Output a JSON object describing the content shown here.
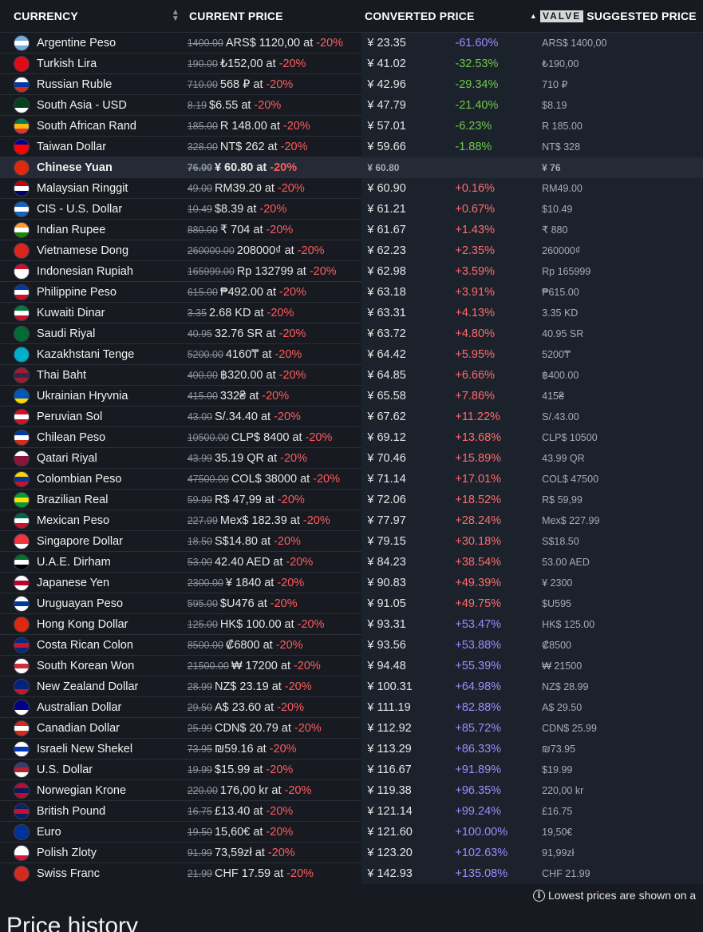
{
  "header": {
    "currency": "CURRENCY",
    "current_price": "CURRENT PRICE",
    "converted_price": "CONVERTED PRICE",
    "valve_logo": "VALVE",
    "suggested_price": "SUGGESTED PRICE"
  },
  "at_word": "at",
  "rows": [
    {
      "name": "Argentine Peso",
      "flag": [
        "#74acdf",
        "#ffffff",
        "#74acdf"
      ],
      "old": "1400.00",
      "now": "ARS$ 1120,00",
      "disc": "-20%",
      "conv": "¥ 23.35",
      "pct": "-61.60%",
      "cls": "pos-big",
      "sugg": "ARS$ 1400,00"
    },
    {
      "name": "Turkish Lira",
      "flag": [
        "#e30a17",
        "#e30a17",
        "#e30a17"
      ],
      "old": "190.00",
      "now": "₺152,00",
      "disc": "-20%",
      "conv": "¥ 41.02",
      "pct": "-32.53%",
      "cls": "neg",
      "sugg": "₺190,00"
    },
    {
      "name": "Russian Ruble",
      "flag": [
        "#ffffff",
        "#0039a6",
        "#d52b1e"
      ],
      "old": "710.00",
      "now": "568 ₽",
      "disc": "-20%",
      "conv": "¥ 42.96",
      "pct": "-29.34%",
      "cls": "neg",
      "sugg": "710 ₽"
    },
    {
      "name": "South Asia - USD",
      "flag": [
        "#01411c",
        "#01411c",
        "#ffffff"
      ],
      "old": "8.19",
      "now": "$6.55",
      "disc": "-20%",
      "conv": "¥ 47.79",
      "pct": "-21.40%",
      "cls": "neg",
      "sugg": "$8.19"
    },
    {
      "name": "South African Rand",
      "flag": [
        "#007a4d",
        "#ffb612",
        "#de3831"
      ],
      "old": "185.00",
      "now": "R 148.00",
      "disc": "-20%",
      "conv": "¥ 57.01",
      "pct": "-6.23%",
      "cls": "neg",
      "sugg": "R 185.00"
    },
    {
      "name": "Taiwan Dollar",
      "flag": [
        "#000095",
        "#fe0000",
        "#fe0000"
      ],
      "old": "328.00",
      "now": "NT$ 262",
      "disc": "-20%",
      "conv": "¥ 59.66",
      "pct": "-1.88%",
      "cls": "neg",
      "sugg": "NT$ 328"
    },
    {
      "name": "Chinese Yuan",
      "flag": [
        "#de2910",
        "#de2910",
        "#de2910"
      ],
      "old": "76.00",
      "now": "¥ 60.80",
      "disc": "-20%",
      "conv": "¥ 60.80",
      "pct": "",
      "cls": "",
      "sugg": "¥ 76",
      "highlight": true
    },
    {
      "name": "Malaysian Ringgit",
      "flag": [
        "#cc0001",
        "#ffffff",
        "#010066"
      ],
      "old": "49.00",
      "now": "RM39.20",
      "disc": "-20%",
      "conv": "¥ 60.90",
      "pct": "+0.16%",
      "cls": "pos-small",
      "sugg": "RM49.00"
    },
    {
      "name": "CIS - U.S. Dollar",
      "flag": [
        "#1565c0",
        "#ffffff",
        "#1565c0"
      ],
      "old": "10.49",
      "now": "$8.39",
      "disc": "-20%",
      "conv": "¥ 61.21",
      "pct": "+0.67%",
      "cls": "pos-small",
      "sugg": "$10.49"
    },
    {
      "name": "Indian Rupee",
      "flag": [
        "#ff9933",
        "#ffffff",
        "#138808"
      ],
      "old": "880.00",
      "now": "₹ 704",
      "disc": "-20%",
      "conv": "¥ 61.67",
      "pct": "+1.43%",
      "cls": "pos-small",
      "sugg": "₹ 880"
    },
    {
      "name": "Vietnamese Dong",
      "flag": [
        "#da251d",
        "#da251d",
        "#da251d"
      ],
      "old": "260000.00",
      "now": "208000₫",
      "disc": "-20%",
      "conv": "¥ 62.23",
      "pct": "+2.35%",
      "cls": "pos-small",
      "sugg": "260000₫"
    },
    {
      "name": "Indonesian Rupiah",
      "flag": [
        "#ce1126",
        "#ffffff",
        "#ffffff"
      ],
      "old": "165999.00",
      "now": "Rp 132799",
      "disc": "-20%",
      "conv": "¥ 62.98",
      "pct": "+3.59%",
      "cls": "pos-small",
      "sugg": "Rp 165999"
    },
    {
      "name": "Philippine Peso",
      "flag": [
        "#0038a8",
        "#ffffff",
        "#ce1126"
      ],
      "old": "615.00",
      "now": "₱492.00",
      "disc": "-20%",
      "conv": "¥ 63.18",
      "pct": "+3.91%",
      "cls": "pos-small",
      "sugg": "₱615.00"
    },
    {
      "name": "Kuwaiti Dinar",
      "flag": [
        "#007a3d",
        "#ffffff",
        "#ce1126"
      ],
      "old": "3.35",
      "now": "2.68 KD",
      "disc": "-20%",
      "conv": "¥ 63.31",
      "pct": "+4.13%",
      "cls": "pos-small",
      "sugg": "3.35 KD"
    },
    {
      "name": "Saudi Riyal",
      "flag": [
        "#006c35",
        "#006c35",
        "#006c35"
      ],
      "old": "40.95",
      "now": "32.76 SR",
      "disc": "-20%",
      "conv": "¥ 63.72",
      "pct": "+4.80%",
      "cls": "pos-small",
      "sugg": "40.95 SR"
    },
    {
      "name": "Kazakhstani Tenge",
      "flag": [
        "#00afca",
        "#00afca",
        "#00afca"
      ],
      "old": "5200.00",
      "now": "4160₸",
      "disc": "-20%",
      "conv": "¥ 64.42",
      "pct": "+5.95%",
      "cls": "pos-small",
      "sugg": "5200₸"
    },
    {
      "name": "Thai Baht",
      "flag": [
        "#a51931",
        "#2d2a4a",
        "#a51931"
      ],
      "old": "400.00",
      "now": "฿320.00",
      "disc": "-20%",
      "conv": "¥ 64.85",
      "pct": "+6.66%",
      "cls": "pos-small",
      "sugg": "฿400.00"
    },
    {
      "name": "Ukrainian Hryvnia",
      "flag": [
        "#0057b7",
        "#0057b7",
        "#ffd700"
      ],
      "old": "415.00",
      "now": "332₴",
      "disc": "-20%",
      "conv": "¥ 65.58",
      "pct": "+7.86%",
      "cls": "pos-small",
      "sugg": "415₴"
    },
    {
      "name": "Peruvian Sol",
      "flag": [
        "#d91023",
        "#ffffff",
        "#d91023"
      ],
      "old": "43.00",
      "now": "S/.34.40",
      "disc": "-20%",
      "conv": "¥ 67.62",
      "pct": "+11.22%",
      "cls": "pos-small",
      "sugg": "S/.43.00"
    },
    {
      "name": "Chilean Peso",
      "flag": [
        "#0039a6",
        "#ffffff",
        "#d52b1e"
      ],
      "old": "10500.00",
      "now": "CLP$ 8400",
      "disc": "-20%",
      "conv": "¥ 69.12",
      "pct": "+13.68%",
      "cls": "pos-small",
      "sugg": "CLP$ 10500"
    },
    {
      "name": "Qatari Riyal",
      "flag": [
        "#ffffff",
        "#8a1538",
        "#8a1538"
      ],
      "old": "43.99",
      "now": "35.19 QR",
      "disc": "-20%",
      "conv": "¥ 70.46",
      "pct": "+15.89%",
      "cls": "pos-small",
      "sugg": "43.99 QR"
    },
    {
      "name": "Colombian Peso",
      "flag": [
        "#fcd116",
        "#003893",
        "#ce1126"
      ],
      "old": "47500.00",
      "now": "COL$ 38000",
      "disc": "-20%",
      "conv": "¥ 71.14",
      "pct": "+17.01%",
      "cls": "pos-small",
      "sugg": "COL$ 47500"
    },
    {
      "name": "Brazilian Real",
      "flag": [
        "#009c3b",
        "#ffdf00",
        "#009c3b"
      ],
      "old": "59.99",
      "now": "R$ 47,99",
      "disc": "-20%",
      "conv": "¥ 72.06",
      "pct": "+18.52%",
      "cls": "pos-small",
      "sugg": "R$ 59,99"
    },
    {
      "name": "Mexican Peso",
      "flag": [
        "#006847",
        "#ffffff",
        "#ce1126"
      ],
      "old": "227.99",
      "now": "Mex$ 182.39",
      "disc": "-20%",
      "conv": "¥ 77.97",
      "pct": "+28.24%",
      "cls": "pos-small",
      "sugg": "Mex$ 227.99"
    },
    {
      "name": "Singapore Dollar",
      "flag": [
        "#ef3340",
        "#ef3340",
        "#ffffff"
      ],
      "old": "18.50",
      "now": "S$14.80",
      "disc": "-20%",
      "conv": "¥ 79.15",
      "pct": "+30.18%",
      "cls": "pos-small",
      "sugg": "S$18.50"
    },
    {
      "name": "U.A.E. Dirham",
      "flag": [
        "#00732f",
        "#ffffff",
        "#000000"
      ],
      "old": "53.00",
      "now": "42.40 AED",
      "disc": "-20%",
      "conv": "¥ 84.23",
      "pct": "+38.54%",
      "cls": "pos-small",
      "sugg": "53.00 AED"
    },
    {
      "name": "Japanese Yen",
      "flag": [
        "#ffffff",
        "#bc002d",
        "#ffffff"
      ],
      "old": "2300.00",
      "now": "¥ 1840",
      "disc": "-20%",
      "conv": "¥ 90.83",
      "pct": "+49.39%",
      "cls": "pos-small",
      "sugg": "¥ 2300"
    },
    {
      "name": "Uruguayan Peso",
      "flag": [
        "#ffffff",
        "#0038a8",
        "#ffffff"
      ],
      "old": "595.00",
      "now": "$U476",
      "disc": "-20%",
      "conv": "¥ 91.05",
      "pct": "+49.75%",
      "cls": "pos-small",
      "sugg": "$U595"
    },
    {
      "name": "Hong Kong Dollar",
      "flag": [
        "#de2910",
        "#de2910",
        "#de2910"
      ],
      "old": "125.00",
      "now": "HK$ 100.00",
      "disc": "-20%",
      "conv": "¥ 93.31",
      "pct": "+53.47%",
      "cls": "pos-big",
      "sugg": "HK$ 125.00"
    },
    {
      "name": "Costa Rican Colon",
      "flag": [
        "#002b7f",
        "#ce1126",
        "#002b7f"
      ],
      "old": "8500.00",
      "now": "₡6800",
      "disc": "-20%",
      "conv": "¥ 93.56",
      "pct": "+53.88%",
      "cls": "pos-big",
      "sugg": "₡8500"
    },
    {
      "name": "South Korean Won",
      "flag": [
        "#ffffff",
        "#cd2e3a",
        "#ffffff"
      ],
      "old": "21500.00",
      "now": "₩ 17200",
      "disc": "-20%",
      "conv": "¥ 94.48",
      "pct": "+55.39%",
      "cls": "pos-big",
      "sugg": "₩ 21500"
    },
    {
      "name": "New Zealand Dollar",
      "flag": [
        "#00247d",
        "#00247d",
        "#cc142b"
      ],
      "old": "28.99",
      "now": "NZ$ 23.19",
      "disc": "-20%",
      "conv": "¥ 100.31",
      "pct": "+64.98%",
      "cls": "pos-big",
      "sugg": "NZ$ 28.99"
    },
    {
      "name": "Australian Dollar",
      "flag": [
        "#00008b",
        "#00008b",
        "#ffffff"
      ],
      "old": "29.50",
      "now": "A$ 23.60",
      "disc": "-20%",
      "conv": "¥ 111.19",
      "pct": "+82.88%",
      "cls": "pos-big",
      "sugg": "A$ 29.50"
    },
    {
      "name": "Canadian Dollar",
      "flag": [
        "#d52b1e",
        "#ffffff",
        "#d52b1e"
      ],
      "old": "25.99",
      "now": "CDN$ 20.79",
      "disc": "-20%",
      "conv": "¥ 112.92",
      "pct": "+85.72%",
      "cls": "pos-big",
      "sugg": "CDN$ 25.99"
    },
    {
      "name": "Israeli New Shekel",
      "flag": [
        "#ffffff",
        "#0038b8",
        "#ffffff"
      ],
      "old": "73.95",
      "now": "₪59.16",
      "disc": "-20%",
      "conv": "¥ 113.29",
      "pct": "+86.33%",
      "cls": "pos-big",
      "sugg": "₪73.95"
    },
    {
      "name": "U.S. Dollar",
      "flag": [
        "#3c3b6e",
        "#b22234",
        "#ffffff"
      ],
      "old": "19.99",
      "now": "$15.99",
      "disc": "-20%",
      "conv": "¥ 116.67",
      "pct": "+91.89%",
      "cls": "pos-big",
      "sugg": "$19.99"
    },
    {
      "name": "Norwegian Krone",
      "flag": [
        "#ba0c2f",
        "#00205b",
        "#ba0c2f"
      ],
      "old": "220.00",
      "now": "176,00 kr",
      "disc": "-20%",
      "conv": "¥ 119.38",
      "pct": "+96.35%",
      "cls": "pos-big",
      "sugg": "220,00 kr"
    },
    {
      "name": "British Pound",
      "flag": [
        "#012169",
        "#c8102e",
        "#012169"
      ],
      "old": "16.75",
      "now": "£13.40",
      "disc": "-20%",
      "conv": "¥ 121.14",
      "pct": "+99.24%",
      "cls": "pos-big",
      "sugg": "£16.75"
    },
    {
      "name": "Euro",
      "flag": [
        "#003399",
        "#003399",
        "#003399"
      ],
      "old": "19.50",
      "now": "15,60€",
      "disc": "-20%",
      "conv": "¥ 121.60",
      "pct": "+100.00%",
      "cls": "pos-big",
      "sugg": "19,50€"
    },
    {
      "name": "Polish Zloty",
      "flag": [
        "#ffffff",
        "#ffffff",
        "#dc143c"
      ],
      "old": "91.99",
      "now": "73,59zł",
      "disc": "-20%",
      "conv": "¥ 123.20",
      "pct": "+102.63%",
      "cls": "pos-big",
      "sugg": "91,99zł"
    },
    {
      "name": "Swiss Franc",
      "flag": [
        "#d52b1e",
        "#d52b1e",
        "#d52b1e"
      ],
      "old": "21.99",
      "now": "CHF 17.59",
      "disc": "-20%",
      "conv": "¥ 142.93",
      "pct": "+135.08%",
      "cls": "pos-big",
      "sugg": "CHF 21.99"
    }
  ],
  "footer": {
    "note": "Lowest prices are shown on a"
  },
  "section": {
    "title": "Price history"
  }
}
